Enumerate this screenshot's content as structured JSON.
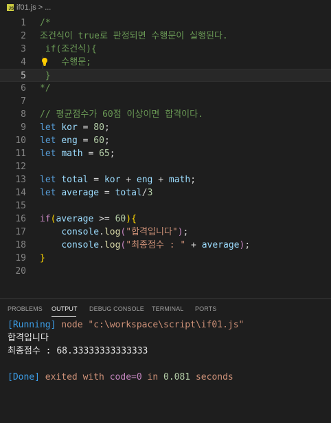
{
  "breadcrumb": {
    "icon_text": "JS",
    "file": "if01.js",
    "separator": ">",
    "more": "..."
  },
  "editor": {
    "lines": [
      {
        "n": "1",
        "parts": [
          {
            "t": "/*",
            "c": "c-comment"
          }
        ]
      },
      {
        "n": "2",
        "parts": [
          {
            "t": "조건식이 true로 판정되면 수행문이 실행된다.",
            "c": "c-comment"
          }
        ]
      },
      {
        "n": "3",
        "parts": [
          {
            "t": " if(조건식){",
            "c": "c-comment"
          }
        ]
      },
      {
        "n": "4",
        "parts": [
          {
            "t": "    수행문;",
            "c": "c-comment"
          }
        ]
      },
      {
        "n": "5",
        "active": true,
        "parts": [
          {
            "t": " }",
            "c": "c-comment"
          }
        ]
      },
      {
        "n": "6",
        "parts": [
          {
            "t": "*/",
            "c": "c-comment"
          }
        ]
      },
      {
        "n": "7",
        "parts": []
      },
      {
        "n": "8",
        "parts": [
          {
            "t": "// 평균점수가 60점 이상이면 합격이다.",
            "c": "c-comment"
          }
        ]
      },
      {
        "n": "9",
        "parts": [
          {
            "t": "let",
            "c": "c-kw"
          },
          {
            "t": " ",
            "c": "c-plain"
          },
          {
            "t": "kor",
            "c": "c-var"
          },
          {
            "t": " = ",
            "c": "c-plain"
          },
          {
            "t": "80",
            "c": "c-num"
          },
          {
            "t": ";",
            "c": "c-plain"
          }
        ]
      },
      {
        "n": "10",
        "parts": [
          {
            "t": "let",
            "c": "c-kw"
          },
          {
            "t": " ",
            "c": "c-plain"
          },
          {
            "t": "eng",
            "c": "c-var"
          },
          {
            "t": " = ",
            "c": "c-plain"
          },
          {
            "t": "60",
            "c": "c-num"
          },
          {
            "t": ";",
            "c": "c-plain"
          }
        ]
      },
      {
        "n": "11",
        "parts": [
          {
            "t": "let",
            "c": "c-kw"
          },
          {
            "t": " ",
            "c": "c-plain"
          },
          {
            "t": "math",
            "c": "c-var"
          },
          {
            "t": " = ",
            "c": "c-plain"
          },
          {
            "t": "65",
            "c": "c-num"
          },
          {
            "t": ";",
            "c": "c-plain"
          }
        ]
      },
      {
        "n": "12",
        "parts": []
      },
      {
        "n": "13",
        "parts": [
          {
            "t": "let",
            "c": "c-kw"
          },
          {
            "t": " ",
            "c": "c-plain"
          },
          {
            "t": "total",
            "c": "c-var"
          },
          {
            "t": " = ",
            "c": "c-plain"
          },
          {
            "t": "kor",
            "c": "c-var"
          },
          {
            "t": " + ",
            "c": "c-plain"
          },
          {
            "t": "eng",
            "c": "c-var"
          },
          {
            "t": " + ",
            "c": "c-plain"
          },
          {
            "t": "math",
            "c": "c-var"
          },
          {
            "t": ";",
            "c": "c-plain"
          }
        ]
      },
      {
        "n": "14",
        "parts": [
          {
            "t": "let",
            "c": "c-kw"
          },
          {
            "t": " ",
            "c": "c-plain"
          },
          {
            "t": "average",
            "c": "c-var"
          },
          {
            "t": " = ",
            "c": "c-plain"
          },
          {
            "t": "total",
            "c": "c-var"
          },
          {
            "t": "/",
            "c": "c-plain"
          },
          {
            "t": "3",
            "c": "c-num"
          }
        ]
      },
      {
        "n": "15",
        "parts": []
      },
      {
        "n": "16",
        "parts": [
          {
            "t": "if",
            "c": "c-ctrl"
          },
          {
            "t": "(",
            "c": "c-brace"
          },
          {
            "t": "average",
            "c": "c-var"
          },
          {
            "t": " >= ",
            "c": "c-plain"
          },
          {
            "t": "60",
            "c": "c-num"
          },
          {
            "t": ")",
            "c": "c-brace"
          },
          {
            "t": "{",
            "c": "c-brace"
          }
        ]
      },
      {
        "n": "17",
        "parts": [
          {
            "t": "    ",
            "c": "c-plain"
          },
          {
            "t": "console",
            "c": "c-var"
          },
          {
            "t": ".",
            "c": "c-plain"
          },
          {
            "t": "log",
            "c": "c-fn"
          },
          {
            "t": "(",
            "c": "c-ctrl"
          },
          {
            "t": "\"합격입니다\"",
            "c": "c-str"
          },
          {
            "t": ")",
            "c": "c-ctrl"
          },
          {
            "t": ";",
            "c": "c-plain"
          }
        ]
      },
      {
        "n": "18",
        "parts": [
          {
            "t": "    ",
            "c": "c-plain"
          },
          {
            "t": "console",
            "c": "c-var"
          },
          {
            "t": ".",
            "c": "c-plain"
          },
          {
            "t": "log",
            "c": "c-fn"
          },
          {
            "t": "(",
            "c": "c-ctrl"
          },
          {
            "t": "\"최종점수 : \"",
            "c": "c-str"
          },
          {
            "t": " + ",
            "c": "c-plain"
          },
          {
            "t": "average",
            "c": "c-var"
          },
          {
            "t": ")",
            "c": "c-ctrl"
          },
          {
            "t": ";",
            "c": "c-plain"
          }
        ]
      },
      {
        "n": "19",
        "parts": [
          {
            "t": "}",
            "c": "c-brace"
          }
        ]
      },
      {
        "n": "20",
        "parts": []
      }
    ]
  },
  "panel": {
    "tabs": [
      "PROBLEMS",
      "OUTPUT",
      "DEBUG CONSOLE",
      "TERMINAL",
      "PORTS"
    ],
    "active_tab": "OUTPUT"
  },
  "output": {
    "running_tag": "[Running]",
    "running_cmd": " node \"c:\\workspace\\script\\if01.js\"",
    "line1": "합격입니다",
    "line2": "최종점수 : 68.33333333333333",
    "done_tag": "[Done]",
    "done_text1": " exited with ",
    "done_code": "code=0",
    "done_text2": " in ",
    "done_time": "0.081",
    "done_text3": " seconds"
  }
}
